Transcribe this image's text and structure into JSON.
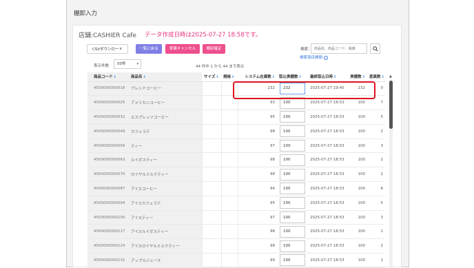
{
  "page": {
    "title": "棚卸入力"
  },
  "store_label": "店舗:CASHIER Cafe",
  "data_time_notice": "データ作成日時は2025-07-27 18:58です。",
  "toolbar": {
    "csv_label": "CSVダウンロード",
    "back_label": "一覧に戻る",
    "cancel_label": "準備キャンセル",
    "confirm_label": "棚卸確定"
  },
  "search": {
    "label": "検索：",
    "placeholder": "商品名、商品コード、版番",
    "advanced_label": "検索項目開閉"
  },
  "per_page": {
    "label": "表示件数",
    "value": "50件"
  },
  "count_text": "44 件中 1 から 44 まで表示",
  "table": {
    "headers": {
      "code": "商品コード",
      "name": "商品名",
      "size": "サイズ",
      "spec": "規格",
      "system_stock": "システム在庫数",
      "import_actual": "取込実棚数",
      "last_import": "最終取込日時",
      "actual": "実棚数",
      "diff": "差異数"
    },
    "rows": [
      {
        "code": "4500000000018",
        "name": "ブレンドコーヒー",
        "size": "",
        "spec": "",
        "system_stock": "232",
        "import_actual": "232",
        "last_import": "2025-07-27 19:45",
        "actual": "232",
        "diff": "0"
      },
      {
        "code": "4500000000025",
        "name": "アメリカンコーヒー",
        "size": "",
        "spec": "",
        "system_stock": "93",
        "import_actual": "100",
        "last_import": "2025-07-27 18:53",
        "actual": "100",
        "diff": "7"
      },
      {
        "code": "4500000000032",
        "name": "エスプレッソコーヒー",
        "size": "",
        "spec": "",
        "system_stock": "95",
        "import_actual": "100",
        "last_import": "2025-07-27 18:53",
        "actual": "100",
        "diff": "5"
      },
      {
        "code": "4500000000049",
        "name": "カフェラテ",
        "size": "",
        "spec": "",
        "system_stock": "98",
        "import_actual": "100",
        "last_import": "2025-07-27 18:53",
        "actual": "100",
        "diff": "2"
      },
      {
        "code": "4500000000056",
        "name": "ティー",
        "size": "",
        "spec": "",
        "system_stock": "97",
        "import_actual": "100",
        "last_import": "2025-07-27 18:53",
        "actual": "100",
        "diff": "3"
      },
      {
        "code": "4500000000063",
        "name": "ルイボスティー",
        "size": "",
        "spec": "",
        "system_stock": "98",
        "import_actual": "100",
        "last_import": "2025-07-27 18:53",
        "actual": "100",
        "diff": "2"
      },
      {
        "code": "4500000000070",
        "name": "ロイヤルミルクティー",
        "size": "",
        "spec": "",
        "system_stock": "98",
        "import_actual": "100",
        "last_import": "2025-07-27 18:53",
        "actual": "100",
        "diff": "2"
      },
      {
        "code": "4500000000087",
        "name": "アイスコーヒー",
        "size": "",
        "spec": "",
        "system_stock": "94",
        "import_actual": "100",
        "last_import": "2025-07-27 18:53",
        "actual": "100",
        "diff": "6"
      },
      {
        "code": "4500000000094",
        "name": "アイスカフェラテ",
        "size": "",
        "spec": "",
        "system_stock": "95",
        "import_actual": "100",
        "last_import": "2025-07-27 18:53",
        "actual": "100",
        "diff": "5"
      },
      {
        "code": "4500000000100",
        "name": "アイスティー",
        "size": "",
        "spec": "",
        "system_stock": "97",
        "import_actual": "100",
        "last_import": "2025-07-27 18:53",
        "actual": "100",
        "diff": "3"
      },
      {
        "code": "4500000000117",
        "name": "アイスルイボスティー",
        "size": "",
        "spec": "",
        "system_stock": "98",
        "import_actual": "100",
        "last_import": "2025-07-27 18:53",
        "actual": "100",
        "diff": "2"
      },
      {
        "code": "4500000000124",
        "name": "アイスロイヤルミルクティー",
        "size": "",
        "spec": "",
        "system_stock": "98",
        "import_actual": "100",
        "last_import": "2025-07-27 18:53",
        "actual": "100",
        "diff": "2"
      },
      {
        "code": "4500000000131",
        "name": "アップルジュース",
        "size": "",
        "spec": "",
        "system_stock": "99",
        "import_actual": "100",
        "last_import": "2025-07-27 18:53",
        "actual": "100",
        "diff": "1"
      }
    ]
  },
  "colors": {
    "accent_pink": "#ee4f8d",
    "accent_purple": "#7f7fe6",
    "highlight_red": "#e0101e",
    "link_blue": "#3b7be0"
  }
}
